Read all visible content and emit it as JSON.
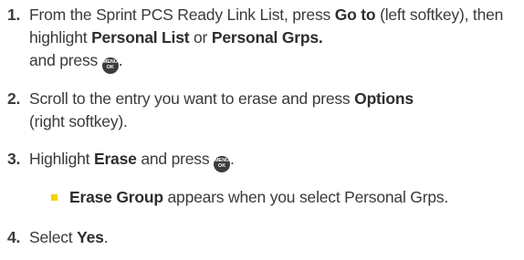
{
  "steps": [
    {
      "number": "1.",
      "parts": {
        "a": "From the Sprint PCS Ready Link List, press ",
        "b": "Go to",
        "c": " (left softkey), then highlight ",
        "d": "Personal List",
        "e": " or ",
        "f": "Personal Grps.",
        "g": " and press ",
        "h": "."
      }
    },
    {
      "number": "2.",
      "parts": {
        "a": "Scroll to the entry you want to erase and press ",
        "b": "Options",
        "c": " (right softkey)."
      }
    },
    {
      "number": "3.",
      "parts": {
        "a": "Highlight ",
        "b": "Erase",
        "c": " and press ",
        "d": "."
      }
    },
    {
      "number": "4.",
      "parts": {
        "a": "Select ",
        "b": "Yes",
        "c": "."
      }
    }
  ],
  "bullet": {
    "bold": "Erase Group",
    "rest": " appears when you select Personal Grps."
  },
  "menu_key": {
    "icon": "menu-ok-key-icon",
    "line1": "MENU",
    "line2": "OK"
  },
  "colors": {
    "text": "#3a3a3a",
    "bullet": "#f5d200",
    "key": "#3c3c3c"
  }
}
